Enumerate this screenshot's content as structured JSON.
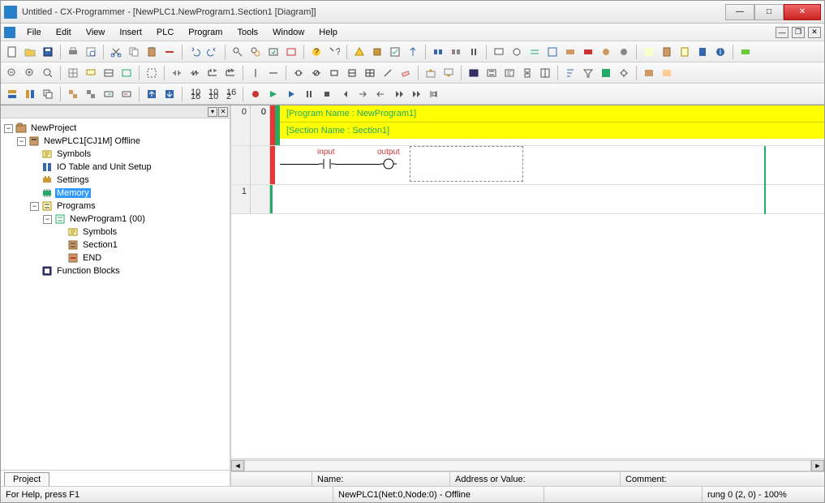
{
  "window": {
    "title": "Untitled - CX-Programmer - [NewPLC1.NewProgram1.Section1 [Diagram]]"
  },
  "menu": {
    "items": [
      "File",
      "Edit",
      "View",
      "Insert",
      "PLC",
      "Program",
      "Tools",
      "Window",
      "Help"
    ]
  },
  "tree": {
    "root": "NewProject",
    "plc": "NewPLC1[CJ1M] Offline",
    "symbols": "Symbols",
    "iotable": "IO Table and Unit Setup",
    "settings": "Settings",
    "memory": "Memory",
    "programs": "Programs",
    "newprogram": "NewProgram1 (00)",
    "progsymbols": "Symbols",
    "section1": "Section1",
    "end": "END",
    "funcblocks": "Function Blocks",
    "tab": "Project"
  },
  "diagram": {
    "rung0": "0",
    "rung0sub": "0",
    "rung1": "1",
    "program_name": "[Program Name : NewProgram1]",
    "section_name": "[Section Name : Section1]",
    "input_label": "input",
    "output_label": "output"
  },
  "status": {
    "name_label": "Name:",
    "addr_label": "Address or Value:",
    "comment_label": "Comment:",
    "help": "For Help, press F1",
    "plc_status": "NewPLC1(Net:0,Node:0) - Offline",
    "rung_info": "rung 0 (2, 0)  - 100%"
  }
}
